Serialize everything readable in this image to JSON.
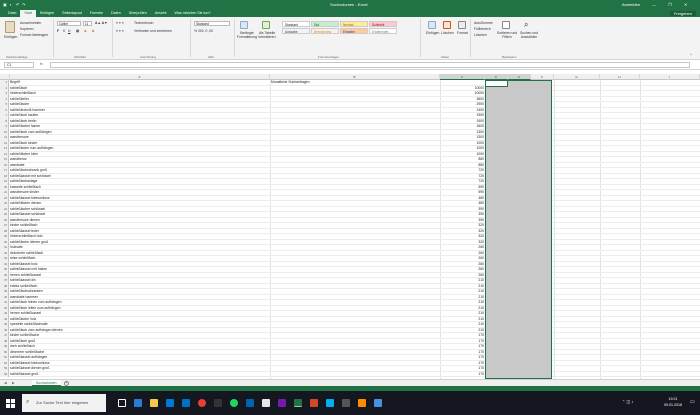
{
  "window": {
    "title": "Suchvolumen - Excel",
    "user": "Anmelden"
  },
  "ribbon_tabs": [
    "Datei",
    "Start",
    "Einfügen",
    "Seitenlayout",
    "Formeln",
    "Daten",
    "Überprüfen",
    "Ansicht",
    "Was möchten Sie tun?"
  ],
  "active_tab": "Start",
  "share_label": "Freigeben",
  "ribbon": {
    "paste": "Einfügen",
    "cut": "Ausschneiden",
    "copy": "Kopieren",
    "format_painter": "Format übertragen",
    "font_name": "Calibri",
    "font_size": "11",
    "wrap_text": "Textumbruch",
    "merge_center": "Verbinden und zentrieren",
    "number_format": "Standard",
    "conditional_format": "Bedingte Formatierung",
    "format_as_table": "Als Tabelle formatieren",
    "styles": [
      {
        "label": "Standard",
        "bg": "#ffffff",
        "fg": "#222222"
      },
      {
        "label": "Gut",
        "bg": "#c6efce",
        "fg": "#006100"
      },
      {
        "label": "Neutral",
        "bg": "#ffeb9c",
        "fg": "#9c6500"
      },
      {
        "label": "Schlecht",
        "bg": "#ffc7ce",
        "fg": "#9c0006"
      },
      {
        "label": "Ausgabe",
        "bg": "#f2f2f2",
        "fg": "#3f3f3f"
      },
      {
        "label": "Berechnung",
        "bg": "#f2f2f2",
        "fg": "#fa7d00"
      },
      {
        "label": "Eingabe",
        "bg": "#ffcc99",
        "fg": "#3f3f76"
      },
      {
        "label": "Erklärender...",
        "bg": "#ffffff",
        "fg": "#7f7f7f"
      },
      {
        "label": "Notiz",
        "bg": "#ffffcc",
        "fg": "#222222"
      },
      {
        "label": "Überschrift",
        "bg": "#ffffff",
        "fg": "#222222"
      }
    ],
    "insert": "Einfügen",
    "delete": "Löschen",
    "format": "Format",
    "autosum": "AutoSumme",
    "fill": "Füllbereich",
    "clear": "Löschen",
    "sort_filter": "Sortieren und Filtern",
    "find_select": "Suchen und Auswählen",
    "groups": [
      "Zwischenablage",
      "Schriftart",
      "Ausrichtung",
      "Zahl",
      "Formatvorlagen",
      "Zellen",
      "Bearbeiten"
    ]
  },
  "name_box": "C1",
  "fx_label": "fx",
  "columns": [
    "A",
    "B",
    "C",
    "D",
    "E",
    "F",
    "G",
    "H",
    "I"
  ],
  "header_row": {
    "a": "Begriff",
    "b": "Monatliche Suchanfragen"
  },
  "rows": [
    {
      "n": "2",
      "a": "schließfach",
      "c": "10000"
    },
    {
      "n": "3",
      "a": "hinterschließfach",
      "c": "10000"
    },
    {
      "n": "4",
      "a": "schließkeller",
      "c": "3600"
    },
    {
      "n": "5",
      "a": "schließfache",
      "c": "2900"
    },
    {
      "n": "6",
      "a": "schließtechnik hammer",
      "c": "2400"
    },
    {
      "n": "7",
      "a": "schließfach kaufen",
      "c": "1900"
    },
    {
      "n": "8",
      "a": "schließfach berlin",
      "c": "1900"
    },
    {
      "n": "9",
      "a": "schließfachel hamm",
      "c": "1600"
    },
    {
      "n": "10",
      "a": "schließfach zum aufhängen",
      "c": "1300"
    },
    {
      "n": "11",
      "a": "wandtresore",
      "c": "1300"
    },
    {
      "n": "12",
      "a": "schließfach kinder",
      "c": "1000"
    },
    {
      "n": "13",
      "a": "schließfache zum aufhängen",
      "c": "1000"
    },
    {
      "n": "14",
      "a": "schließfächer klein",
      "c": "1000"
    },
    {
      "n": "15",
      "a": "wandtresor",
      "c": "880"
    },
    {
      "n": "16",
      "a": "wandsafe",
      "c": "880"
    },
    {
      "n": "17",
      "a": "schließfachschrank groß",
      "c": "720"
    },
    {
      "n": "18",
      "a": "schließkassel mit schlüssel",
      "c": "720"
    },
    {
      "n": "19",
      "a": "schließfachanlage",
      "c": "720"
    },
    {
      "n": "20",
      "a": "kassette schließfach",
      "c": "590"
    },
    {
      "n": "21",
      "a": "wandtresore kinder",
      "c": "590"
    },
    {
      "n": "22",
      "a": "schließkassel kleinschloss",
      "c": "480"
    },
    {
      "n": "23",
      "a": "schließfächer dienen",
      "c": "480"
    },
    {
      "n": "24",
      "a": "schließfacher schlüssel",
      "c": "390"
    },
    {
      "n": "25",
      "a": "schließkassel schlüssel",
      "c": "390"
    },
    {
      "n": "26",
      "a": "wandtresore dienen",
      "c": "390"
    },
    {
      "n": "27",
      "a": "kinder schließfach",
      "c": "320"
    },
    {
      "n": "28",
      "a": "schließkassel leder",
      "c": "320"
    },
    {
      "n": "29",
      "a": "hinterschließfach holz",
      "c": "320"
    },
    {
      "n": "30",
      "a": "schließfache dienen groß",
      "c": "320"
    },
    {
      "n": "31",
      "a": "holzsafe",
      "c": "260"
    },
    {
      "n": "32",
      "a": "dekorierte schließfach",
      "c": "260"
    },
    {
      "n": "33",
      "a": "reise schließfach",
      "c": "260"
    },
    {
      "n": "34",
      "a": "schließkassel holz",
      "c": "260"
    },
    {
      "n": "35",
      "a": "schließkassen mit haken",
      "c": "260"
    },
    {
      "n": "36",
      "a": "herren schließkassel",
      "c": "260"
    },
    {
      "n": "37",
      "a": "schließkassel din",
      "c": "210"
    },
    {
      "n": "38",
      "a": "edeka schließfach",
      "c": "210"
    },
    {
      "n": "39",
      "a": "schließfachschranken",
      "c": "210"
    },
    {
      "n": "40",
      "a": "wandsafe hammer",
      "c": "210"
    },
    {
      "n": "41",
      "a": "schließfach leinen zum aufhängen",
      "c": "210"
    },
    {
      "n": "42",
      "a": "schließfach leiten zum aufhängen",
      "c": "210"
    },
    {
      "n": "43",
      "a": "herren schließkassel",
      "c": "210"
    },
    {
      "n": "44",
      "a": "schließfache holz",
      "c": "210"
    },
    {
      "n": "45",
      "a": "spezielle schließfachsafe",
      "c": "210"
    },
    {
      "n": "46",
      "a": "schließfach zum aufhängen dienen",
      "c": "210"
    },
    {
      "n": "47",
      "a": "kinder schließfache",
      "c": "170"
    },
    {
      "n": "48",
      "a": "schließfach groß",
      "c": "170"
    },
    {
      "n": "49",
      "a": "dreh schließfach",
      "c": "170"
    },
    {
      "n": "50",
      "a": "dimmreer schließfache",
      "c": "170"
    },
    {
      "n": "51",
      "a": "schließkassel aufhängen",
      "c": "170"
    },
    {
      "n": "52",
      "a": "schließkassel kleinschloss",
      "c": "170"
    },
    {
      "n": "53",
      "a": "schließkassel dienen groß",
      "c": "170"
    },
    {
      "n": "54",
      "a": "schließkassel groß",
      "c": "170"
    }
  ],
  "sheet_tab": "Suchvolumen",
  "add_sheet": "+",
  "taskbar": {
    "search_placeholder": "Zur Suche Text hier eingeben",
    "time": "19:21",
    "date": "09.01.2018"
  },
  "colors": {
    "excel_green": "#217346",
    "selection_fill": "#c8c8c8",
    "taskbar": "#14171f"
  }
}
